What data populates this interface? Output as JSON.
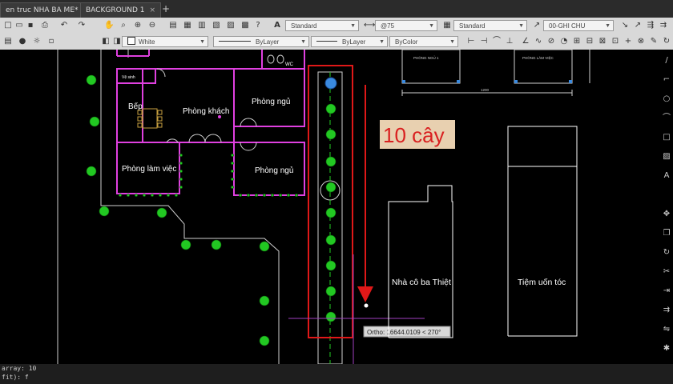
{
  "tabs": [
    {
      "label": "en truc NHA BA ME*",
      "close": "×"
    },
    {
      "label": "BACKGROUND 1",
      "close": "×"
    }
  ],
  "tab_add": "+",
  "toolbar": {
    "text_style": "Standard",
    "dim_scale": "@75",
    "table_style": "Standard",
    "multileader_style": "00-GHI CHU",
    "color": "White",
    "linetype": "ByLayer",
    "lineweight": "ByLayer",
    "plotstyle": "ByColor"
  },
  "drawing": {
    "rooms": {
      "kitchen": "Bếp",
      "living": "Phòng khách",
      "bedroom1": "Phòng ngủ",
      "study": "Phòng làm việc",
      "bedroom2": "Phòng ngủ",
      "small": "Vệ sinh",
      "wc_label": "WC"
    },
    "top_buildings": {
      "left": "PHÒNG NGỦ 1",
      "right": "PHÒNG LÀM VIỆC",
      "dim": "1200"
    },
    "annotation": "10 cây",
    "house_label": "Nhà cô ba Thiệt",
    "shop_label": "Tiệm uốn tóc",
    "tooltip": "Ortho: 16644.0109 < 270°"
  },
  "command_line": {
    "line1": "array: 10",
    "line2": "fit): f"
  },
  "colors": {
    "magenta": "#e040e0",
    "tree_green": "#22c822",
    "annotation_red": "#d92020",
    "annotation_bg": "#e8d0b0"
  }
}
